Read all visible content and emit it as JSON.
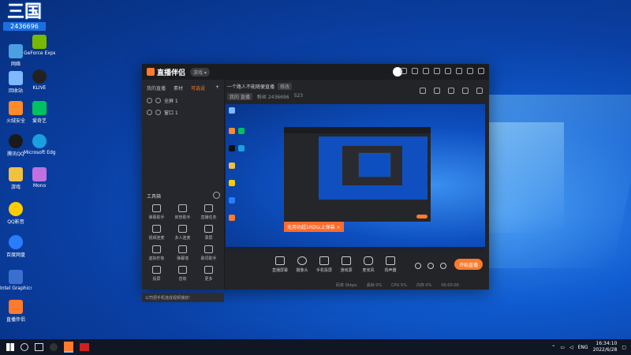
{
  "desktop": {
    "banner_text": "三国",
    "banner_sub": "2436696",
    "icons": [
      {
        "label": "网络",
        "color": "#4aa0e0"
      },
      {
        "label": "GeForce Experience",
        "color": "#76b900"
      },
      {
        "label": "回收站",
        "color": "#7fb8ff"
      },
      {
        "label": "KLIVE",
        "color": "#222"
      },
      {
        "label": "火绒安全",
        "color": "#ff8a2a"
      },
      {
        "label": "爱奇艺",
        "color": "#00c060"
      },
      {
        "label": "腾讯QQ",
        "color": "#1a1a1a"
      },
      {
        "label": "Microsoft Edge",
        "color": "#1aa0e0"
      },
      {
        "label": "游戏",
        "color": "#f0c040"
      },
      {
        "label": "Mono",
        "color": "#c070e0"
      },
      {
        "label": "QQ影音",
        "color": "#ffcc00"
      },
      {
        "label": "百度网盘",
        "color": "#2a7cff"
      },
      {
        "label": "Intel Graphics",
        "color": "#3a6fd0"
      },
      {
        "label": "直播伴侣",
        "color": "#ff7a2d"
      }
    ]
  },
  "app": {
    "title": "直播伴侣",
    "badge": "游戏 ▾",
    "tabs": [
      "我的直播",
      "素材",
      "可选设",
      "+"
    ],
    "sources": [
      {
        "label": "全屏 1"
      },
      {
        "label": "窗口 1"
      }
    ],
    "room_title": "一个路人不能随便直播",
    "room_tag": "修改",
    "room_stats": [
      "我的 直播",
      "粉丝 2436696",
      "523"
    ],
    "toolbox_title": "工具箱",
    "tools": [
      {
        "label": "弹幕助手"
      },
      {
        "label": "房管助手"
      },
      {
        "label": "直播任务"
      },
      {
        "label": "视频连麦"
      },
      {
        "label": "多人连麦"
      },
      {
        "label": "录屏"
      },
      {
        "label": "虚拟形象"
      },
      {
        "label": "弹幕墙"
      },
      {
        "label": "歌词助手"
      },
      {
        "label": "投屏"
      },
      {
        "label": "音效"
      },
      {
        "label": "更多"
      }
    ],
    "tip": "公司把手机连成视频播放!",
    "banner": "无用功超1RD以上弹幕 ×",
    "controls": [
      {
        "label": "直播屏幕"
      },
      {
        "label": "摄像头"
      },
      {
        "label": "手机投屏"
      },
      {
        "label": "游戏源"
      },
      {
        "label": "麦克风"
      },
      {
        "label": "扬声器"
      }
    ],
    "start_live": "开始直播",
    "status": [
      "码率 0kbps",
      "丢帧 0%",
      "CPU 5%",
      "内存 0%",
      "00:00:00"
    ]
  },
  "taskbar": {
    "tray": "ENG",
    "time": "16:34:10",
    "date": "2022/6/28"
  }
}
